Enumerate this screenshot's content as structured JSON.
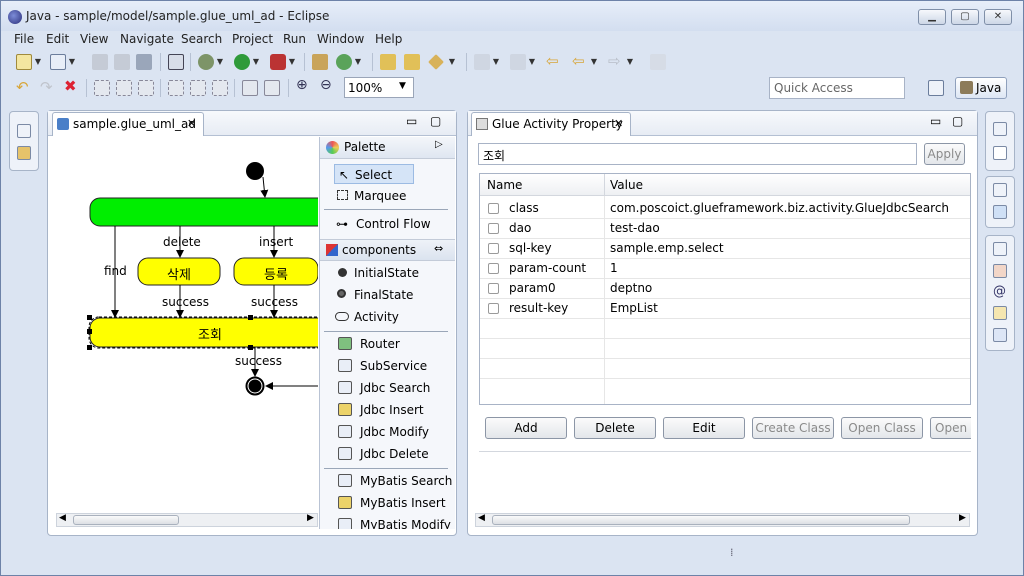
{
  "window": {
    "title": "Java - sample/model/sample.glue_uml_ad - Eclipse"
  },
  "menu": [
    "File",
    "Edit",
    "View",
    "Navigate",
    "Search",
    "Project",
    "Run",
    "Window",
    "Help"
  ],
  "toolbar": {
    "zoom": "100%",
    "quick_access": "Quick Access",
    "perspective": "Java"
  },
  "editor": {
    "tab": "sample.glue_uml_ad",
    "nodes": {
      "delete_node": "삭제",
      "insert_node": "등록",
      "query_node": "조회"
    },
    "labels": {
      "delete": "delete",
      "insert": "insert",
      "find": "find",
      "success_left": "success",
      "success_right": "success",
      "success_bottom": "success"
    }
  },
  "palette": {
    "title": "Palette",
    "tools": [
      "Select",
      "Marquee"
    ],
    "control_flow": "Control Flow",
    "components": "components",
    "states": [
      "InitialState",
      "FinalState",
      "Activity"
    ],
    "services": [
      "Router",
      "SubService",
      "Jdbc Search",
      "Jdbc Insert",
      "Jdbc Modify",
      "Jdbc Delete"
    ],
    "mybatis": [
      "MyBatis Search",
      "MyBatis Insert",
      "MyBatis Modify"
    ]
  },
  "property_view": {
    "tab": "Glue Activity Property",
    "name_field": "조회",
    "apply": "Apply",
    "columns": [
      "Name",
      "Value"
    ],
    "rows": [
      {
        "name": "class",
        "value": "com.poscoict.glueframework.biz.activity.GlueJdbcSearch"
      },
      {
        "name": "dao",
        "value": "test-dao"
      },
      {
        "name": "sql-key",
        "value": "sample.emp.select"
      },
      {
        "name": "param-count",
        "value": "1"
      },
      {
        "name": "param0",
        "value": "deptno"
      },
      {
        "name": "result-key",
        "value": "EmpList"
      }
    ],
    "buttons": [
      "Add",
      "Delete",
      "Edit",
      "Create Class",
      "Open Class",
      "Open S"
    ]
  }
}
